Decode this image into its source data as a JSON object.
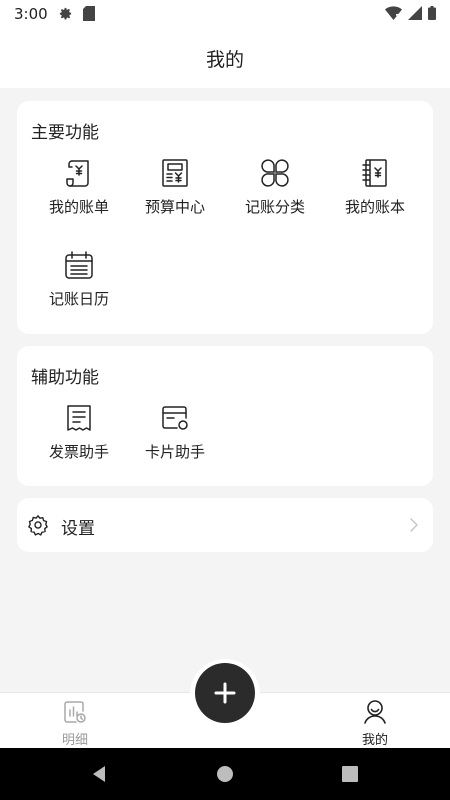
{
  "status_bar": {
    "time": "3:00"
  },
  "header": {
    "title": "我的"
  },
  "main_features": {
    "title": "主要功能",
    "items": [
      {
        "label": "我的账单",
        "icon": "bill-icon"
      },
      {
        "label": "预算中心",
        "icon": "budget-icon"
      },
      {
        "label": "记账分类",
        "icon": "category-icon"
      },
      {
        "label": "我的账本",
        "icon": "ledger-book-icon"
      },
      {
        "label": "记账日历",
        "icon": "calendar-icon"
      }
    ]
  },
  "aux_features": {
    "title": "辅助功能",
    "items": [
      {
        "label": "发票助手",
        "icon": "invoice-icon"
      },
      {
        "label": "卡片助手",
        "icon": "card-icon"
      }
    ]
  },
  "settings": {
    "label": "设置"
  },
  "bottom_nav": {
    "tabs": [
      {
        "label": "明细",
        "active": false
      },
      {
        "label": "我的",
        "active": true
      }
    ],
    "fab": "add-icon"
  },
  "colors": {
    "background": "#f4f4f4",
    "card": "#ffffff",
    "text": "#222222",
    "inactive": "#9a9a9a",
    "fab": "#2b2b2b"
  }
}
